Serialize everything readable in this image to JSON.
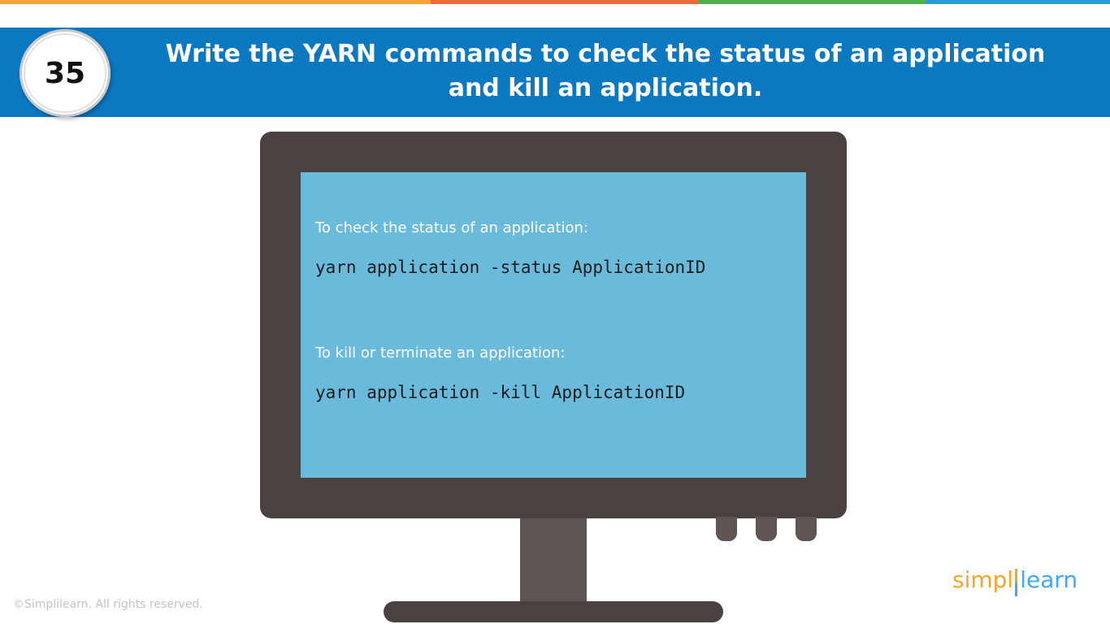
{
  "colors": {
    "stripe_orange": "#f4a533",
    "stripe_red": "#ef6a3a",
    "stripe_green": "#4fae4c",
    "stripe_blue": "#2a9ad6",
    "header_blue": "#0b78c0",
    "monitor_frame": "#4a4240",
    "screen_blue": "#6abbdb",
    "stand": "#5f5654",
    "logo_orange": "#f5a623",
    "logo_blue": "#3fa9f5"
  },
  "header": {
    "question_number": "35",
    "title_line_1": "Write the YARN commands to check the status of an application",
    "title_line_2": "and kill an application."
  },
  "screen": {
    "check_caption": "To check the status of an application:",
    "check_command": "yarn application -status ApplicationID",
    "kill_caption": "To kill or terminate an application:",
    "kill_command": "yarn application -kill ApplicationID"
  },
  "footer": {
    "copyright": "©Simplilearn. All rights reserved.",
    "logo_part_1": "simpl",
    "logo_part_2": "learn"
  }
}
